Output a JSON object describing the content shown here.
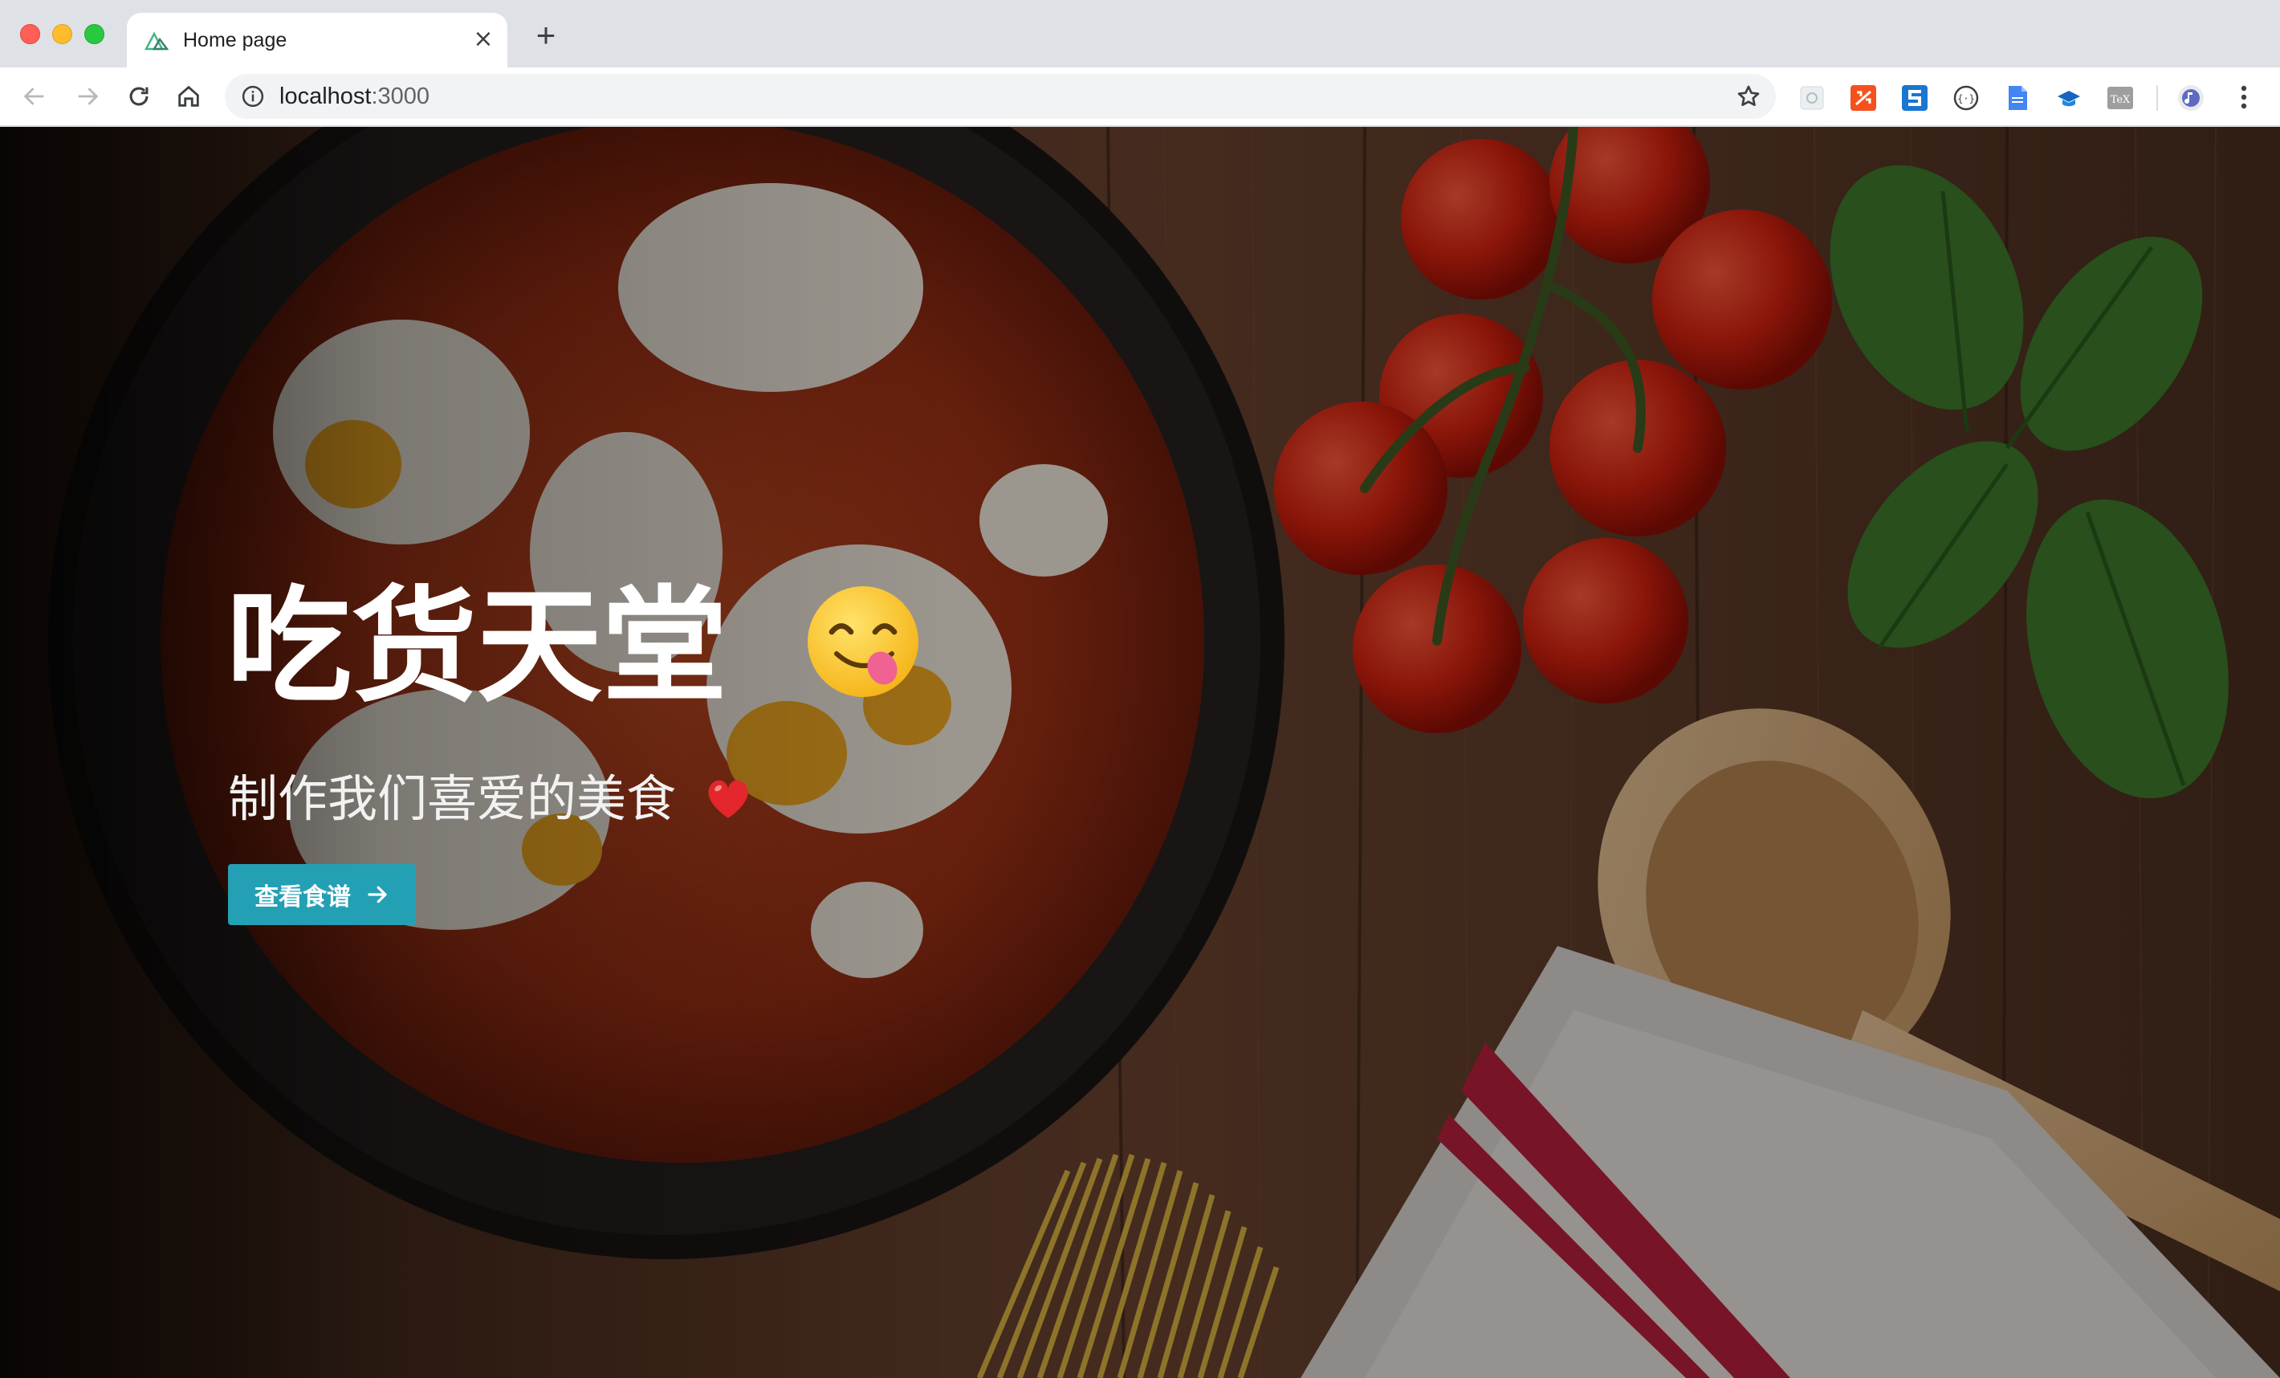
{
  "browser": {
    "tab": {
      "title": "Home page",
      "close_symbol": "×"
    },
    "new_tab_symbol": "+",
    "omnibox": {
      "host": "localhost",
      "port": ":3000"
    },
    "extensions": [
      "ext-1-icon",
      "ext-2-icon",
      "ext-3-icon",
      "ext-4-icon",
      "ext-5-icon",
      "ext-6-icon",
      "ext-7-icon"
    ]
  },
  "hero": {
    "title": "吃货天堂",
    "title_emoji": "yum-face-emoji",
    "subtitle": "制作我们喜爱的美食",
    "subtitle_emoji": "red-heart-emoji",
    "cta_label": "查看食谱",
    "cta_color": "#24a0b4"
  }
}
